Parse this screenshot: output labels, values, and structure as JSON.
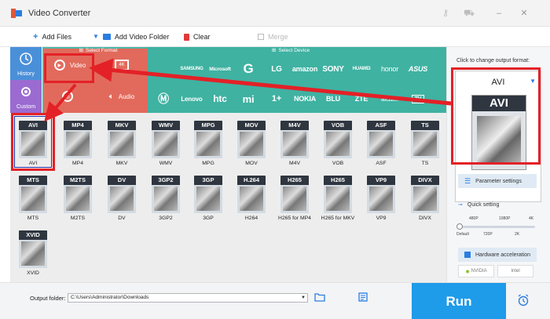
{
  "window": {
    "title": "Video Converter"
  },
  "toolbar": {
    "add_files": "Add Files",
    "add_video_folder": "Add Video Folder",
    "clear": "Clear",
    "merge": "Merge"
  },
  "sidebar": {
    "history": "History",
    "custom": "Custom"
  },
  "headers": {
    "select_format": "Select Format",
    "select_device": "Select Device"
  },
  "categories": {
    "video": "Video",
    "hd": "4K",
    "web": "",
    "audio": "Audio"
  },
  "devices": {
    "row1": [
      "",
      "SAMSUNG",
      "Microsoft",
      "G",
      "LG",
      "amazon",
      "SONY",
      "HUAWEI",
      "honor",
      "ASUS"
    ],
    "row2": [
      "",
      "Lenovo",
      "htc",
      "mi",
      "1+",
      "NOKIA",
      "BLU",
      "ZTE",
      "alcatel",
      "TV"
    ]
  },
  "formats": {
    "row1": [
      {
        "tag": "AVI",
        "name": "AVI"
      },
      {
        "tag": "MP4",
        "name": "MP4"
      },
      {
        "tag": "MKV",
        "name": "MKV"
      },
      {
        "tag": "WMV",
        "name": "WMV"
      },
      {
        "tag": "MPG",
        "name": "MPG"
      },
      {
        "tag": "MOV",
        "name": "MOV"
      },
      {
        "tag": "M4V",
        "name": "M4V"
      },
      {
        "tag": "VOB",
        "name": "VOB"
      },
      {
        "tag": "ASF",
        "name": "ASF"
      },
      {
        "tag": "TS",
        "name": "TS"
      }
    ],
    "row2": [
      {
        "tag": "MTS",
        "name": "MTS"
      },
      {
        "tag": "M2TS",
        "name": "M2TS"
      },
      {
        "tag": "DV",
        "name": "DV"
      },
      {
        "tag": "3GP2",
        "name": "3GP2"
      },
      {
        "tag": "3GP",
        "name": "3GP"
      },
      {
        "tag": "H.264",
        "name": "H264"
      },
      {
        "tag": "H265",
        "name": "H265 for MP4"
      },
      {
        "tag": "H265",
        "name": "H265 for MKV"
      },
      {
        "tag": "VP9",
        "name": "VP9"
      },
      {
        "tag": "DIVX",
        "name": "DIVX"
      }
    ],
    "row3": [
      {
        "tag": "XVID",
        "name": "XVID"
      }
    ]
  },
  "output": {
    "click_label": "Click to change output format:",
    "format_name": "AVI",
    "icon_tag": "AVI",
    "parameter_settings": "Parameter settings",
    "quick_setting": "Quick setting",
    "quality_top": [
      "480P",
      "1080P",
      "4K"
    ],
    "quality_bottom": [
      "Default",
      "720P",
      "2K"
    ],
    "quality_level": 0.0,
    "hardware_acceleration": "Hardware acceleration",
    "nvidia": "NVIDIA",
    "intel": "Intel"
  },
  "bottom": {
    "output_folder_label": "Output folder:",
    "output_folder_path": "C:\\Users\\Administrator\\Downloads",
    "run": "Run"
  },
  "colors": {
    "accent": "#1e9be9",
    "teal": "#4db7a8",
    "highlight": "#e32127"
  }
}
